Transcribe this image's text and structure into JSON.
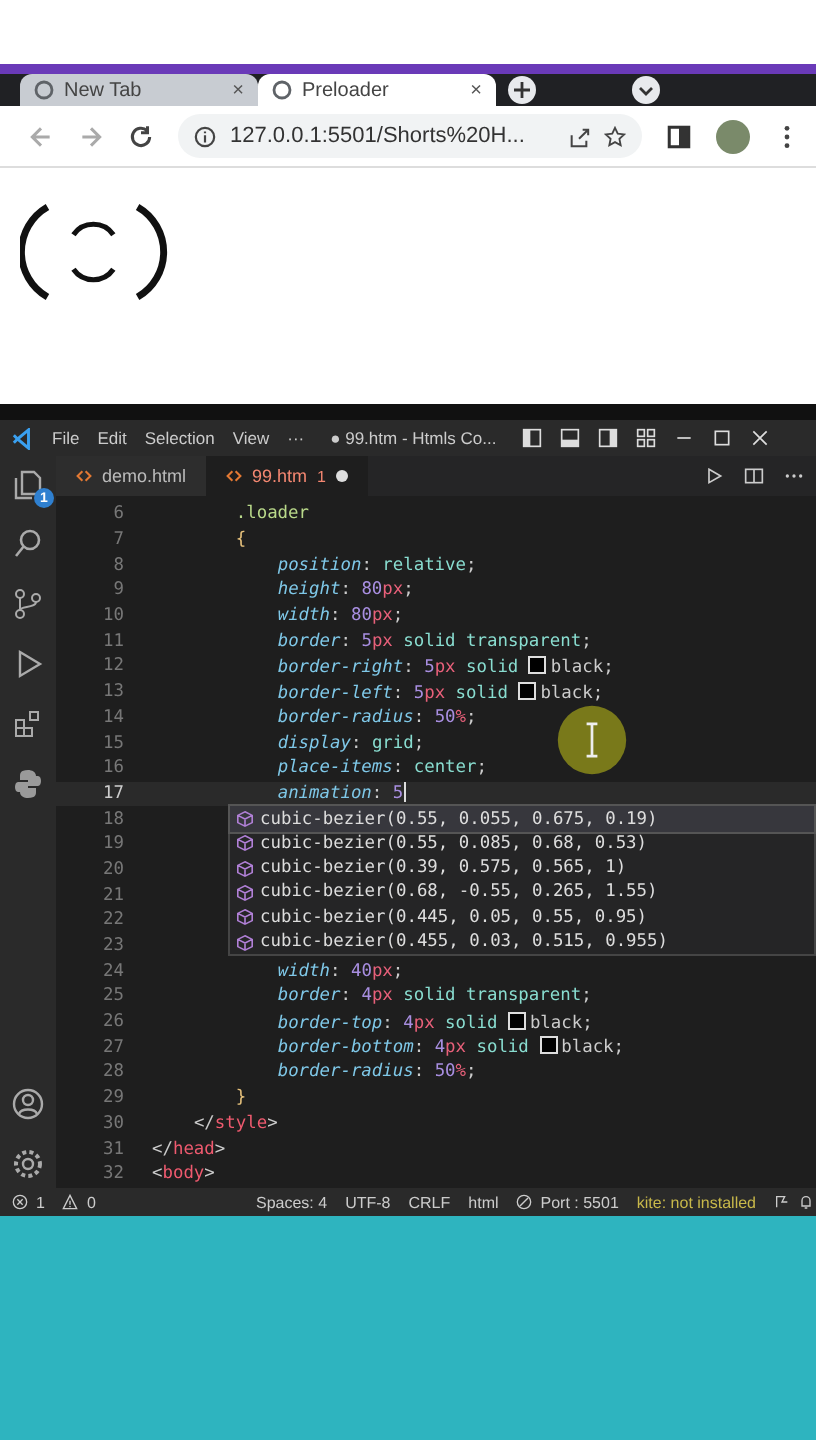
{
  "browser": {
    "tabs": [
      {
        "title": "New Tab",
        "close": "×",
        "selected": false
      },
      {
        "title": "Preloader",
        "close": "×",
        "selected": true
      }
    ],
    "address": "127.0.0.1:5501/Shorts%20H..."
  },
  "editor": {
    "menu": [
      "File",
      "Edit",
      "Selection",
      "View",
      "···"
    ],
    "title": "● 99.htm - Htmls Co...",
    "explorer_badge": "1",
    "tabs": [
      {
        "name": "demo.html",
        "modified": false,
        "selected": false
      },
      {
        "name": "99.htm",
        "problems": "1",
        "modified": true,
        "selected": true
      }
    ],
    "lines": [
      {
        "number": "6",
        "kind": "rule",
        "current": false,
        "tokens": [
          {
            "kind": "selector",
            "text": ".loader"
          }
        ]
      },
      {
        "number": "7",
        "kind": "rule",
        "current": false,
        "tokens": [
          {
            "kind": "brace",
            "text": "{"
          }
        ]
      },
      {
        "number": "8",
        "kind": "decl",
        "current": false,
        "tokens": [
          {
            "kind": "prop",
            "text": "position"
          },
          {
            "kind": "punct",
            "text": ": "
          },
          {
            "kind": "value",
            "text": "relative"
          },
          {
            "kind": "punct",
            "text": ";"
          }
        ]
      },
      {
        "number": "9",
        "kind": "decl",
        "current": false,
        "tokens": [
          {
            "kind": "prop",
            "text": "height"
          },
          {
            "kind": "punct",
            "text": ": "
          },
          {
            "kind": "num",
            "text": "80"
          },
          {
            "kind": "unit",
            "text": "px"
          },
          {
            "kind": "punct",
            "text": ";"
          }
        ]
      },
      {
        "number": "10",
        "kind": "decl",
        "current": false,
        "tokens": [
          {
            "kind": "prop",
            "text": "width"
          },
          {
            "kind": "punct",
            "text": ": "
          },
          {
            "kind": "num",
            "text": "80"
          },
          {
            "kind": "unit",
            "text": "px"
          },
          {
            "kind": "punct",
            "text": ";"
          }
        ]
      },
      {
        "number": "11",
        "kind": "decl",
        "current": false,
        "tokens": [
          {
            "kind": "prop",
            "text": "border"
          },
          {
            "kind": "punct",
            "text": ": "
          },
          {
            "kind": "num",
            "text": "5"
          },
          {
            "kind": "unit",
            "text": "px"
          },
          {
            "kind": "value",
            "text": " solid transparent"
          },
          {
            "kind": "punct",
            "text": ";"
          }
        ]
      },
      {
        "number": "12",
        "kind": "decl",
        "current": false,
        "tokens": [
          {
            "kind": "prop",
            "text": "border-right"
          },
          {
            "kind": "punct",
            "text": ": "
          },
          {
            "kind": "num",
            "text": "5"
          },
          {
            "kind": "unit",
            "text": "px"
          },
          {
            "kind": "value",
            "text": " solid "
          },
          {
            "kind": "swatch",
            "text": "black"
          },
          {
            "kind": "punct",
            "text": ";"
          }
        ]
      },
      {
        "number": "13",
        "kind": "decl",
        "current": false,
        "tokens": [
          {
            "kind": "prop",
            "text": "border-left"
          },
          {
            "kind": "punct",
            "text": ": "
          },
          {
            "kind": "num",
            "text": "5"
          },
          {
            "kind": "unit",
            "text": "px"
          },
          {
            "kind": "value",
            "text": " solid "
          },
          {
            "kind": "swatch",
            "text": "black"
          },
          {
            "kind": "punct",
            "text": ";"
          }
        ]
      },
      {
        "number": "14",
        "kind": "decl",
        "current": false,
        "tokens": [
          {
            "kind": "prop",
            "text": "border-radius"
          },
          {
            "kind": "punct",
            "text": ": "
          },
          {
            "kind": "num",
            "text": "50"
          },
          {
            "kind": "unit",
            "text": "%"
          },
          {
            "kind": "punct",
            "text": ";"
          }
        ]
      },
      {
        "number": "15",
        "kind": "decl",
        "current": false,
        "tokens": [
          {
            "kind": "prop",
            "text": "display"
          },
          {
            "kind": "punct",
            "text": ": "
          },
          {
            "kind": "value",
            "text": "grid"
          },
          {
            "kind": "punct",
            "text": ";"
          }
        ]
      },
      {
        "number": "16",
        "kind": "decl",
        "current": false,
        "tokens": [
          {
            "kind": "prop",
            "text": "place-items"
          },
          {
            "kind": "punct",
            "text": ": "
          },
          {
            "kind": "value",
            "text": "center"
          },
          {
            "kind": "punct",
            "text": ";"
          }
        ]
      },
      {
        "number": "17",
        "kind": "decl",
        "current": true,
        "tokens": [
          {
            "kind": "prop",
            "text": "animation"
          },
          {
            "kind": "punct",
            "text": ": "
          },
          {
            "kind": "num",
            "text": "5"
          }
        ]
      },
      {
        "number": "18",
        "current": false
      },
      {
        "number": "19",
        "current": false
      },
      {
        "number": "20",
        "current": false
      },
      {
        "number": "21",
        "current": false
      },
      {
        "number": "22",
        "current": false
      },
      {
        "number": "23",
        "current": false
      },
      {
        "number": "24",
        "kind": "decl",
        "current": false,
        "tokens": [
          {
            "kind": "prop",
            "text": "width"
          },
          {
            "kind": "punct",
            "text": ": "
          },
          {
            "kind": "num",
            "text": "40"
          },
          {
            "kind": "unit",
            "text": "px"
          },
          {
            "kind": "punct",
            "text": ";"
          }
        ]
      },
      {
        "number": "25",
        "kind": "decl",
        "current": false,
        "tokens": [
          {
            "kind": "prop",
            "text": "border"
          },
          {
            "kind": "punct",
            "text": ": "
          },
          {
            "kind": "num",
            "text": "4"
          },
          {
            "kind": "unit",
            "text": "px"
          },
          {
            "kind": "value",
            "text": " solid transparent"
          },
          {
            "kind": "punct",
            "text": ";"
          }
        ]
      },
      {
        "number": "26",
        "kind": "decl",
        "current": false,
        "tokens": [
          {
            "kind": "prop",
            "text": "border-top"
          },
          {
            "kind": "punct",
            "text": ": "
          },
          {
            "kind": "num",
            "text": "4"
          },
          {
            "kind": "unit",
            "text": "px"
          },
          {
            "kind": "value",
            "text": " solid "
          },
          {
            "kind": "swatch",
            "text": "black"
          },
          {
            "kind": "punct",
            "text": ";"
          }
        ]
      },
      {
        "number": "27",
        "kind": "decl",
        "current": false,
        "tokens": [
          {
            "kind": "prop",
            "text": "border-bottom"
          },
          {
            "kind": "punct",
            "text": ": "
          },
          {
            "kind": "num",
            "text": "4"
          },
          {
            "kind": "unit",
            "text": "px"
          },
          {
            "kind": "value",
            "text": " solid "
          },
          {
            "kind": "swatch",
            "text": "black"
          },
          {
            "kind": "punct",
            "text": ";"
          }
        ]
      },
      {
        "number": "28",
        "kind": "decl",
        "current": false,
        "tokens": [
          {
            "kind": "prop",
            "text": "border-radius"
          },
          {
            "kind": "punct",
            "text": ": "
          },
          {
            "kind": "num",
            "text": "50"
          },
          {
            "kind": "unit",
            "text": "%"
          },
          {
            "kind": "punct",
            "text": ";"
          }
        ]
      },
      {
        "number": "29",
        "kind": "rule",
        "current": false,
        "tokens": [
          {
            "kind": "brace",
            "text": "}"
          }
        ]
      },
      {
        "number": "30",
        "kind": "inner-tag",
        "current": false,
        "tokens": [
          {
            "kind": "punct",
            "text": "</"
          },
          {
            "kind": "tag",
            "text": "style"
          },
          {
            "kind": "punct",
            "text": ">"
          }
        ]
      },
      {
        "number": "31",
        "kind": "tag",
        "current": false,
        "tokens": [
          {
            "kind": "punct",
            "text": "</"
          },
          {
            "kind": "tag",
            "text": "head"
          },
          {
            "kind": "punct",
            "text": ">"
          }
        ]
      },
      {
        "number": "32",
        "kind": "tag",
        "current": false,
        "tokens": [
          {
            "kind": "punct",
            "text": "<"
          },
          {
            "kind": "tag",
            "text": "body"
          },
          {
            "kind": "punct",
            "text": ">"
          }
        ]
      }
    ],
    "suggestions": [
      {
        "text": "cubic-bezier(0.55, 0.055, 0.675, 0.19)",
        "selected": true
      },
      {
        "text": "cubic-bezier(0.55, 0.085, 0.68, 0.53)",
        "selected": false
      },
      {
        "text": "cubic-bezier(0.39, 0.575, 0.565, 1)",
        "selected": false
      },
      {
        "text": "cubic-bezier(0.68, -0.55, 0.265, 1.55)",
        "selected": false
      },
      {
        "text": "cubic-bezier(0.445, 0.05, 0.55, 0.95)",
        "selected": false
      },
      {
        "text": "cubic-bezier(0.455, 0.03, 0.515, 0.955)",
        "selected": false
      }
    ],
    "status": {
      "errors": "1",
      "warnings": "0",
      "items": [
        "Spaces: 4",
        "UTF-8",
        "CRLF",
        "html"
      ],
      "port": "Port : 5501",
      "kite": "kite: not installed"
    }
  }
}
